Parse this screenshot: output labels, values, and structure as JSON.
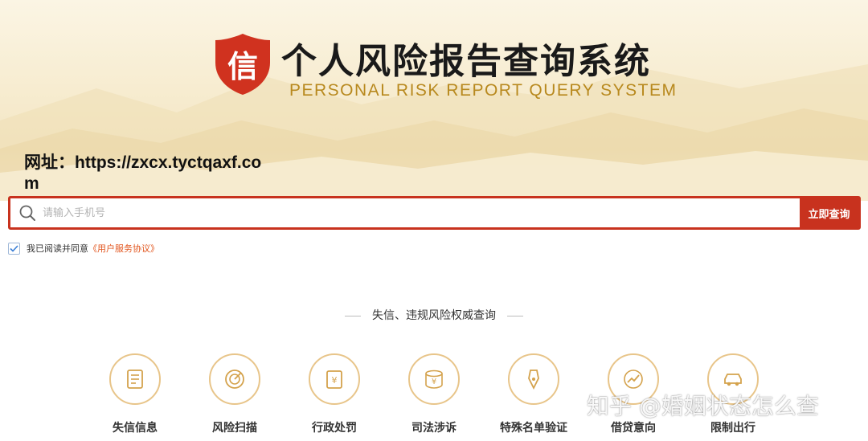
{
  "header": {
    "logo_char": "信",
    "title_cn": "个人风险报告查询系统",
    "title_en": "PERSONAL RISK REPORT QUERY SYSTEM",
    "brand_color": "#d0321f",
    "gold_color": "#b8891e"
  },
  "url_notice": "网址：https://zxcx.tyctqaxf.com",
  "search": {
    "placeholder": "请输入手机号",
    "value": "",
    "button_label": "立即查询",
    "icon": "search-icon"
  },
  "agreement": {
    "checked": true,
    "text": "我已阅读并同意",
    "link_text": "《用户服务协议》"
  },
  "section": {
    "title": "失信、违规风险权威查询"
  },
  "features": [
    {
      "label": "失信信息",
      "icon": "document-icon"
    },
    {
      "label": "风险扫描",
      "icon": "radar-icon"
    },
    {
      "label": "行政处罚",
      "icon": "yuan-notice-icon"
    },
    {
      "label": "司法涉诉",
      "icon": "coin-stack-icon"
    },
    {
      "label": "特殊名单验证",
      "icon": "pen-icon"
    },
    {
      "label": "借贷意向",
      "icon": "trend-icon"
    },
    {
      "label": "限制出行",
      "icon": "car-icon"
    }
  ],
  "watermark": "知乎 @婚姻状态怎么查"
}
